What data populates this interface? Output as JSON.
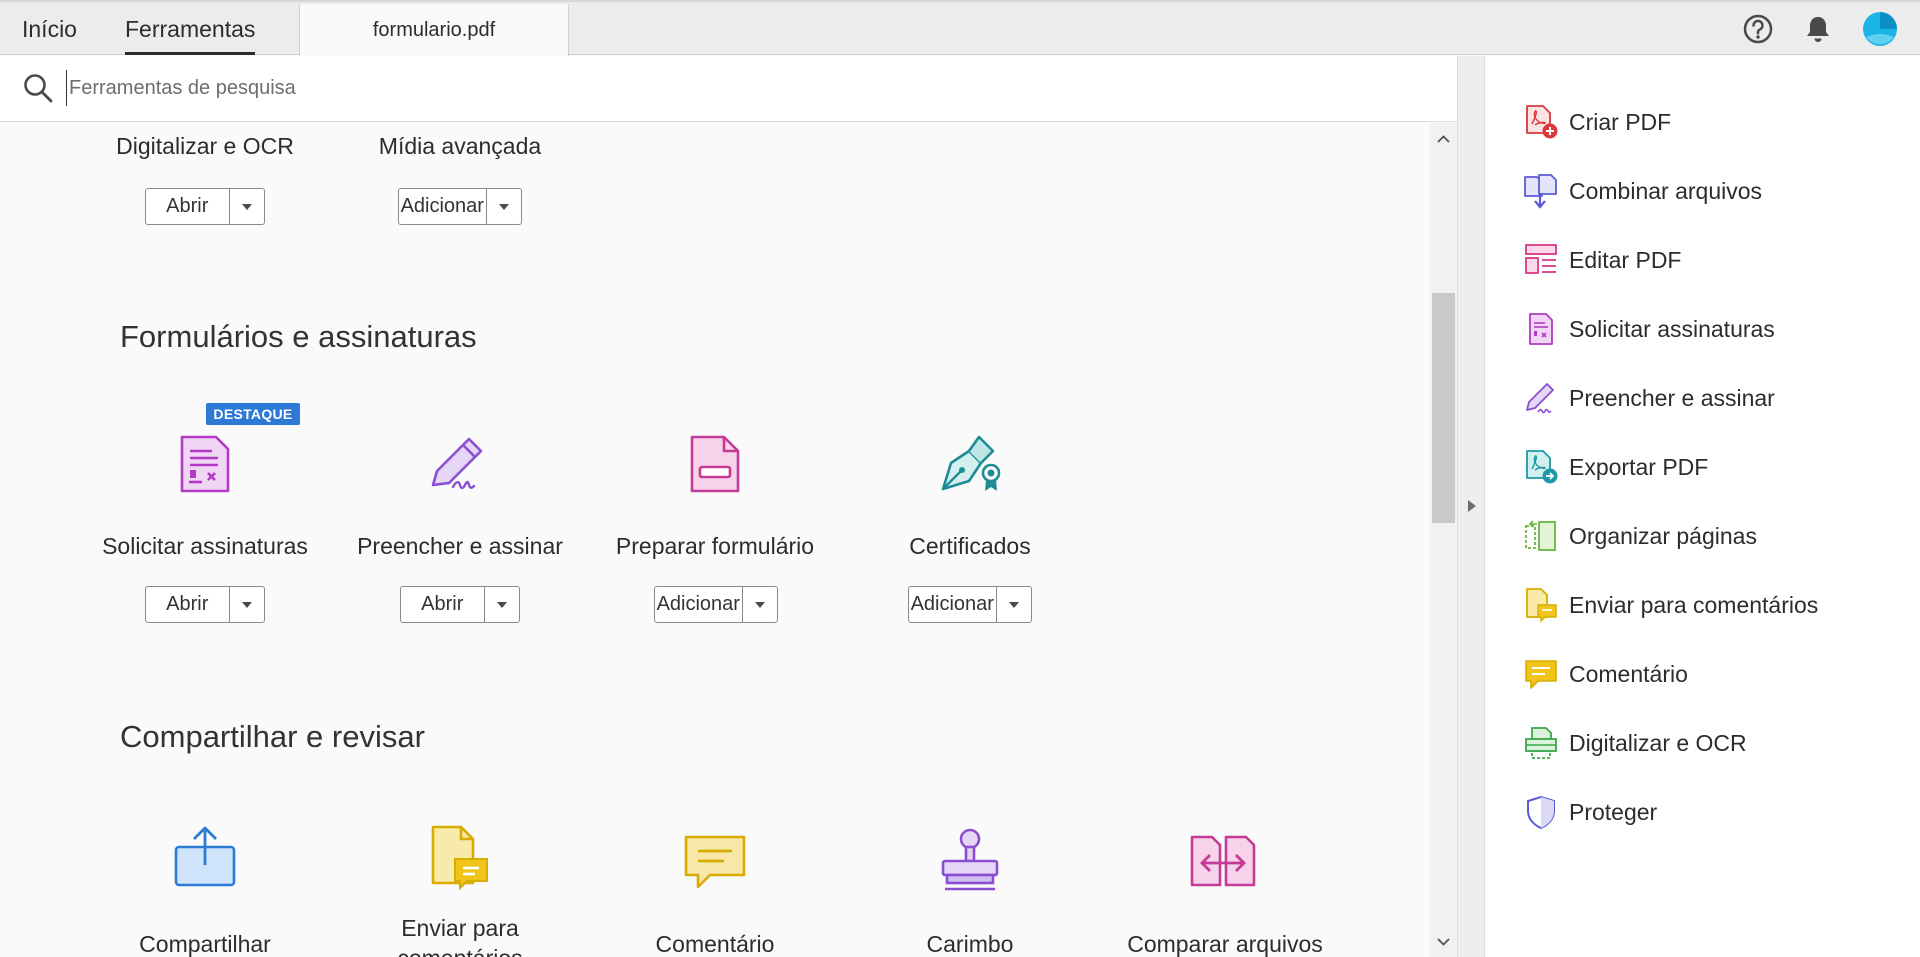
{
  "tabs": {
    "home": "Início",
    "tools": "Ferramentas",
    "document": "formulario.pdf"
  },
  "top_icons": [
    "help-icon",
    "bell-icon",
    "avatar"
  ],
  "search": {
    "placeholder": "Ferramentas de pesquisa"
  },
  "sections": [
    {
      "title": "",
      "tools": [
        {
          "label": "Digitalizar e OCR",
          "button": "Abrir"
        },
        {
          "label": "Mídia avançada",
          "button": "Adicionar"
        }
      ]
    },
    {
      "title": "Formulários e assinaturas",
      "tools": [
        {
          "label": "Solicitar assinaturas",
          "button": "Abrir",
          "badge": "DESTAQUE"
        },
        {
          "label": "Preencher e assinar",
          "button": "Abrir"
        },
        {
          "label": "Preparar formulário",
          "button": "Adicionar"
        },
        {
          "label": "Certificados",
          "button": "Adicionar"
        }
      ]
    },
    {
      "title": "Compartilhar e revisar",
      "tools": [
        {
          "label": "Compartilhar"
        },
        {
          "label": "Enviar para comentários"
        },
        {
          "label": "Comentário"
        },
        {
          "label": "Carimbo"
        },
        {
          "label": "Comparar arquivos"
        }
      ]
    }
  ],
  "right_panel": [
    {
      "label": "Criar PDF",
      "icon": "create-pdf-icon",
      "color": "#d9393b"
    },
    {
      "label": "Combinar arquivos",
      "icon": "combine-files-icon",
      "color": "#5b5bd6"
    },
    {
      "label": "Editar PDF",
      "icon": "edit-pdf-icon",
      "color": "#d63a87"
    },
    {
      "label": "Solicitar assinaturas",
      "icon": "request-signatures-icon",
      "color": "#b23ac4"
    },
    {
      "label": "Preencher e assinar",
      "icon": "fill-sign-icon",
      "color": "#8a4fd1"
    },
    {
      "label": "Exportar PDF",
      "icon": "export-pdf-icon",
      "color": "#1d9aa5"
    },
    {
      "label": "Organizar páginas",
      "icon": "organize-pages-icon",
      "color": "#6cb33f"
    },
    {
      "label": "Enviar para comentários",
      "icon": "send-for-comments-icon",
      "color": "#e2b714"
    },
    {
      "label": "Comentário",
      "icon": "comment-icon",
      "color": "#e2b714"
    },
    {
      "label": "Digitalizar e OCR",
      "icon": "scan-ocr-icon",
      "color": "#3aa84a"
    },
    {
      "label": "Proteger",
      "icon": "protect-icon",
      "color": "#5b5bd6"
    }
  ]
}
